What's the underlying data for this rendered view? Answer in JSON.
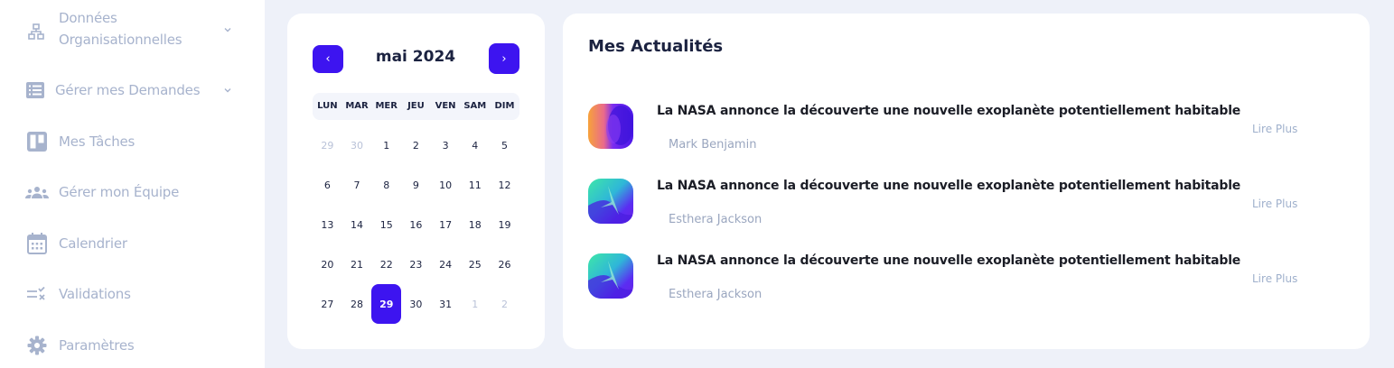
{
  "sidebar": {
    "items": [
      {
        "label_line1": "Données",
        "label_line2": "Organisationnelles",
        "icon": "sitemap-icon",
        "expandable": true
      },
      {
        "label": "Gérer mes Demandes",
        "icon": "list-icon",
        "expandable": true
      },
      {
        "label": "Mes Tâches",
        "icon": "board-icon"
      },
      {
        "label": "Gérer mon Équipe",
        "icon": "team-icon"
      },
      {
        "label": "Calendrier",
        "icon": "calendar-icon"
      },
      {
        "label": "Validations",
        "icon": "validations-icon"
      },
      {
        "label": "Paramètres",
        "icon": "gear-icon"
      }
    ]
  },
  "calendar": {
    "month_label": "mai 2024",
    "prev_label": "‹",
    "next_label": "›",
    "weekdays": [
      "LUN",
      "MAR",
      "MER",
      "JEU",
      "VEN",
      "SAM",
      "DIM"
    ],
    "weeks": [
      [
        "29",
        "30",
        "1",
        "2",
        "3",
        "4",
        "5"
      ],
      [
        "6",
        "7",
        "8",
        "9",
        "10",
        "11",
        "12"
      ],
      [
        "13",
        "14",
        "15",
        "16",
        "17",
        "18",
        "19"
      ],
      [
        "20",
        "21",
        "22",
        "23",
        "24",
        "25",
        "26"
      ],
      [
        "27",
        "28",
        "29",
        "30",
        "31",
        "1",
        "2"
      ]
    ],
    "selected_day": "29",
    "accent_color": "#3d14f0"
  },
  "news": {
    "title": "Mes Actualités",
    "items": [
      {
        "headline": "La NASA annonce la découverte une nouvelle exoplanète potentiellement habitable",
        "author": "Mark Benjamin",
        "more_label": "Lire Plus"
      },
      {
        "headline": "La NASA annonce la découverte une nouvelle exoplanète potentiellement habitable",
        "author": "Esthera Jackson",
        "more_label": "Lire Plus"
      },
      {
        "headline": "La NASA annonce la découverte une nouvelle exoplanète potentiellement habitable",
        "author": "Esthera Jackson",
        "more_label": "Lire Plus"
      }
    ]
  }
}
